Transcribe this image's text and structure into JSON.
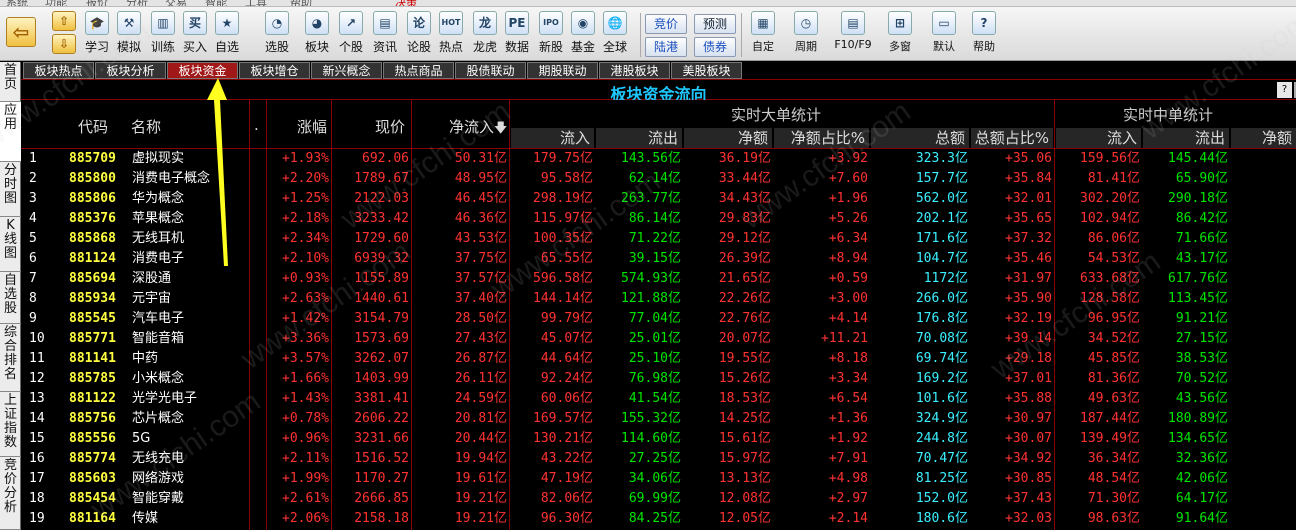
{
  "menu": [
    "系统",
    "功能",
    "报价",
    "分析",
    "交易",
    "智能",
    "工具",
    "帮助",
    "决策"
  ],
  "toolbar": {
    "items": [
      {
        "label": "学习",
        "icon": "mortarboard-icon",
        "glyph": "🎓"
      },
      {
        "label": "模拟",
        "icon": "gavel-icon",
        "glyph": "⚒"
      },
      {
        "label": "训练",
        "icon": "candlestick-icon",
        "glyph": "▥"
      },
      {
        "label": "买入",
        "icon": "buy-icon",
        "glyph": "买"
      },
      {
        "label": "自选",
        "icon": "star-list-icon",
        "glyph": "★"
      },
      {
        "label": "选股",
        "icon": "screener-icon",
        "glyph": "◔"
      },
      {
        "label": "板块",
        "icon": "pie-chart-icon",
        "glyph": "◕"
      },
      {
        "label": "个股",
        "icon": "line-chart-icon",
        "glyph": "↗"
      },
      {
        "label": "资讯",
        "icon": "news-icon",
        "glyph": "▤"
      },
      {
        "label": "论股",
        "icon": "forum-icon",
        "glyph": "论"
      },
      {
        "label": "热点",
        "icon": "hot-icon",
        "glyph": "HOT"
      },
      {
        "label": "龙虎",
        "icon": "dragon-tiger-icon",
        "glyph": "龙"
      },
      {
        "label": "数据",
        "icon": "pe-data-icon",
        "glyph": "PE"
      },
      {
        "label": "新股",
        "icon": "ipo-icon",
        "glyph": "IPO"
      },
      {
        "label": "基金",
        "icon": "fund-icon",
        "glyph": "◉"
      },
      {
        "label": "全球",
        "icon": "globe-icon",
        "glyph": "🌐"
      }
    ],
    "square_buttons": [
      "竞价",
      "预测",
      "陆港",
      "债券"
    ],
    "right_items": [
      {
        "label": "自定",
        "icon": "custom-icon",
        "glyph": "▦"
      },
      {
        "label": "周期",
        "icon": "clock-icon",
        "glyph": "◷"
      },
      {
        "label": "F10/F9",
        "icon": "f10-icon",
        "glyph": "▤"
      },
      {
        "label": "多窗",
        "icon": "multi-window-icon",
        "glyph": "⊞"
      },
      {
        "label": "默认",
        "icon": "default-layout-icon",
        "glyph": "▭"
      },
      {
        "label": "帮助",
        "icon": "help-icon",
        "glyph": "?"
      }
    ]
  },
  "sidebar": [
    {
      "label": "首页",
      "active": false
    },
    {
      "label": "应用",
      "active": true
    },
    {
      "label": "分时图",
      "active": false
    },
    {
      "label": "K线图",
      "active": false
    },
    {
      "label": "自选股",
      "active": false
    },
    {
      "label": "综合排名",
      "active": false
    },
    {
      "label": "上证指数",
      "active": false
    },
    {
      "label": "竞价分析",
      "active": false
    }
  ],
  "tabs": [
    {
      "label": "板块热点",
      "active": false
    },
    {
      "label": "板块分析",
      "active": false
    },
    {
      "label": "板块资金",
      "active": true
    },
    {
      "label": "板块增仓",
      "active": false
    },
    {
      "label": "新兴概念",
      "active": false
    },
    {
      "label": "热点商品",
      "active": false
    },
    {
      "label": "股债联动",
      "active": false
    },
    {
      "label": "期股联动",
      "active": false
    },
    {
      "label": "港股板块",
      "active": false
    },
    {
      "label": "美股板块",
      "active": false
    }
  ],
  "table_title": "板块资金流向",
  "title_buttons": [
    "?",
    "▌"
  ],
  "header": {
    "code": "代码",
    "name": "名称",
    "dot": ".",
    "change": "涨幅",
    "price": "现价",
    "net_inflow": "净流入",
    "big_group": "实时大单统计",
    "mid_group": "实时中单统计",
    "big_cols": [
      "流入",
      "流出",
      "净额",
      "净额占比%",
      "总额",
      "总额占比%"
    ],
    "mid_cols": [
      "流入",
      "流出",
      "净额"
    ]
  },
  "colors": {
    "up": "#ff3232",
    "down": "#00e600",
    "code": "#ffff40",
    "total": "#3cf0ff",
    "tab_active": "#a01818",
    "title": "#1ec8ff"
  },
  "rows": [
    {
      "no": "1",
      "code": "885709",
      "name": "虚拟现实",
      "chg": "+1.93%",
      "price": "692.06",
      "net": "50.31亿",
      "bi": "179.75亿",
      "bo": "143.56亿",
      "bn": "36.19亿",
      "bnp": "+3.92",
      "bt": "323.3亿",
      "btp": "+35.06",
      "mi": "159.56亿",
      "mo": "145.44亿"
    },
    {
      "no": "2",
      "code": "885800",
      "name": "消费电子概念",
      "chg": "+2.20%",
      "price": "1789.67",
      "net": "48.95亿",
      "bi": "95.58亿",
      "bo": "62.14亿",
      "bn": "33.44亿",
      "bnp": "+7.60",
      "bt": "157.7亿",
      "btp": "+35.84",
      "mi": "81.41亿",
      "mo": "65.90亿"
    },
    {
      "no": "3",
      "code": "885806",
      "name": "华为概念",
      "chg": "+1.25%",
      "price": "2122.03",
      "net": "46.45亿",
      "bi": "298.19亿",
      "bo": "263.77亿",
      "bn": "34.43亿",
      "bnp": "+1.96",
      "bt": "562.0亿",
      "btp": "+32.01",
      "mi": "302.20亿",
      "mo": "290.18亿"
    },
    {
      "no": "4",
      "code": "885376",
      "name": "苹果概念",
      "chg": "+2.18%",
      "price": "3233.42",
      "net": "46.36亿",
      "bi": "115.97亿",
      "bo": "86.14亿",
      "bn": "29.83亿",
      "bnp": "+5.26",
      "bt": "202.1亿",
      "btp": "+35.65",
      "mi": "102.94亿",
      "mo": "86.42亿"
    },
    {
      "no": "5",
      "code": "885868",
      "name": "无线耳机",
      "chg": "+2.34%",
      "price": "1729.60",
      "net": "43.53亿",
      "bi": "100.35亿",
      "bo": "71.22亿",
      "bn": "29.12亿",
      "bnp": "+6.34",
      "bt": "171.6亿",
      "btp": "+37.32",
      "mi": "86.06亿",
      "mo": "71.66亿"
    },
    {
      "no": "6",
      "code": "881124",
      "name": "消费电子",
      "chg": "+2.10%",
      "price": "6939.32",
      "net": "37.75亿",
      "bi": "65.55亿",
      "bo": "39.15亿",
      "bn": "26.39亿",
      "bnp": "+8.94",
      "bt": "104.7亿",
      "btp": "+35.46",
      "mi": "54.53亿",
      "mo": "43.17亿"
    },
    {
      "no": "7",
      "code": "885694",
      "name": "深股通",
      "chg": "+0.93%",
      "price": "1155.89",
      "net": "37.57亿",
      "bi": "596.58亿",
      "bo": "574.93亿",
      "bn": "21.65亿",
      "bnp": "+0.59",
      "bt": "1172亿",
      "btp": "+31.97",
      "mi": "633.68亿",
      "mo": "617.76亿"
    },
    {
      "no": "8",
      "code": "885934",
      "name": "元宇宙",
      "chg": "+2.63%",
      "price": "1440.61",
      "net": "37.40亿",
      "bi": "144.14亿",
      "bo": "121.88亿",
      "bn": "22.26亿",
      "bnp": "+3.00",
      "bt": "266.0亿",
      "btp": "+35.90",
      "mi": "128.58亿",
      "mo": "113.45亿"
    },
    {
      "no": "9",
      "code": "885545",
      "name": "汽车电子",
      "chg": "+1.42%",
      "price": "3154.79",
      "net": "28.50亿",
      "bi": "99.79亿",
      "bo": "77.04亿",
      "bn": "22.76亿",
      "bnp": "+4.14",
      "bt": "176.8亿",
      "btp": "+32.19",
      "mi": "96.95亿",
      "mo": "91.21亿"
    },
    {
      "no": "10",
      "code": "885771",
      "name": "智能音箱",
      "chg": "+3.36%",
      "price": "1573.69",
      "net": "27.43亿",
      "bi": "45.07亿",
      "bo": "25.01亿",
      "bn": "20.07亿",
      "bnp": "+11.21",
      "bt": "70.08亿",
      "btp": "+39.14",
      "mi": "34.52亿",
      "mo": "27.15亿"
    },
    {
      "no": "11",
      "code": "881141",
      "name": "中药",
      "chg": "+3.57%",
      "price": "3262.07",
      "net": "26.87亿",
      "bi": "44.64亿",
      "bo": "25.10亿",
      "bn": "19.55亿",
      "bnp": "+8.18",
      "bt": "69.74亿",
      "btp": "+29.18",
      "mi": "45.85亿",
      "mo": "38.53亿"
    },
    {
      "no": "12",
      "code": "885785",
      "name": "小米概念",
      "chg": "+1.66%",
      "price": "1403.99",
      "net": "26.11亿",
      "bi": "92.24亿",
      "bo": "76.98亿",
      "bn": "15.26亿",
      "bnp": "+3.34",
      "bt": "169.2亿",
      "btp": "+37.01",
      "mi": "81.36亿",
      "mo": "70.52亿"
    },
    {
      "no": "13",
      "code": "881122",
      "name": "光学光电子",
      "chg": "+1.43%",
      "price": "3381.41",
      "net": "24.59亿",
      "bi": "60.06亿",
      "bo": "41.54亿",
      "bn": "18.53亿",
      "bnp": "+6.54",
      "bt": "101.6亿",
      "btp": "+35.88",
      "mi": "49.63亿",
      "mo": "43.56亿"
    },
    {
      "no": "14",
      "code": "885756",
      "name": "芯片概念",
      "chg": "+0.78%",
      "price": "2606.22",
      "net": "20.81亿",
      "bi": "169.57亿",
      "bo": "155.32亿",
      "bn": "14.25亿",
      "bnp": "+1.36",
      "bt": "324.9亿",
      "btp": "+30.97",
      "mi": "187.44亿",
      "mo": "180.89亿"
    },
    {
      "no": "15",
      "code": "885556",
      "name": "5G",
      "chg": "+0.96%",
      "price": "3231.66",
      "net": "20.44亿",
      "bi": "130.21亿",
      "bo": "114.60亿",
      "bn": "15.61亿",
      "bnp": "+1.92",
      "bt": "244.8亿",
      "btp": "+30.07",
      "mi": "139.49亿",
      "mo": "134.65亿"
    },
    {
      "no": "16",
      "code": "885774",
      "name": "无线充电",
      "chg": "+2.11%",
      "price": "1516.52",
      "net": "19.94亿",
      "bi": "43.22亿",
      "bo": "27.25亿",
      "bn": "15.97亿",
      "bnp": "+7.91",
      "bt": "70.47亿",
      "btp": "+34.92",
      "mi": "36.34亿",
      "mo": "32.36亿"
    },
    {
      "no": "17",
      "code": "885603",
      "name": "网络游戏",
      "chg": "+1.99%",
      "price": "1170.27",
      "net": "19.61亿",
      "bi": "47.19亿",
      "bo": "34.06亿",
      "bn": "13.13亿",
      "bnp": "+4.98",
      "bt": "81.25亿",
      "btp": "+30.85",
      "mi": "48.54亿",
      "mo": "42.06亿"
    },
    {
      "no": "18",
      "code": "885454",
      "name": "智能穿戴",
      "chg": "+2.61%",
      "price": "2666.85",
      "net": "19.21亿",
      "bi": "82.06亿",
      "bo": "69.99亿",
      "bn": "12.08亿",
      "bnp": "+2.97",
      "bt": "152.0亿",
      "btp": "+37.43",
      "mi": "71.30亿",
      "mo": "64.17亿"
    },
    {
      "no": "19",
      "code": "881164",
      "name": "传媒",
      "chg": "+2.06%",
      "price": "2158.18",
      "net": "19.21亿",
      "bi": "96.30亿",
      "bo": "84.25亿",
      "bn": "12.05亿",
      "bnp": "+2.14",
      "bt": "180.6亿",
      "btp": "+32.03",
      "mi": "98.63亿",
      "mo": "91.64亿"
    }
  ],
  "watermark": "www.cfchi.com"
}
